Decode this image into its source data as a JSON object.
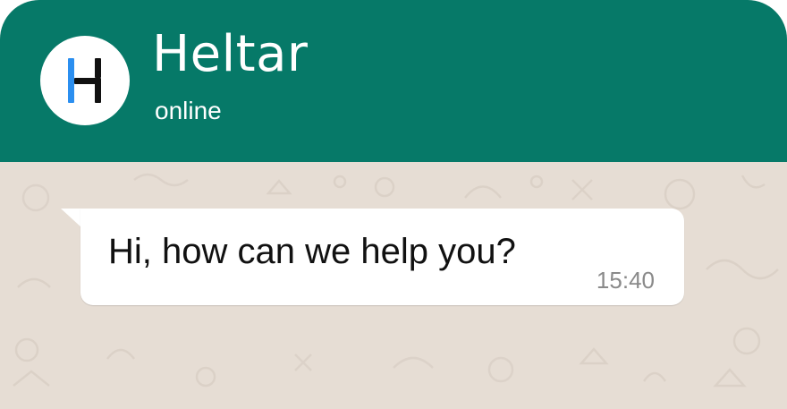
{
  "header": {
    "contact_name": "Heltar",
    "status": "online",
    "avatar_icon": "heltar-logo-icon",
    "background_color": "#067968"
  },
  "chat": {
    "background_color": "#e6ddd4",
    "messages": [
      {
        "direction": "incoming",
        "text": "Hi, how can we help you?",
        "time": "15:40"
      }
    ]
  }
}
